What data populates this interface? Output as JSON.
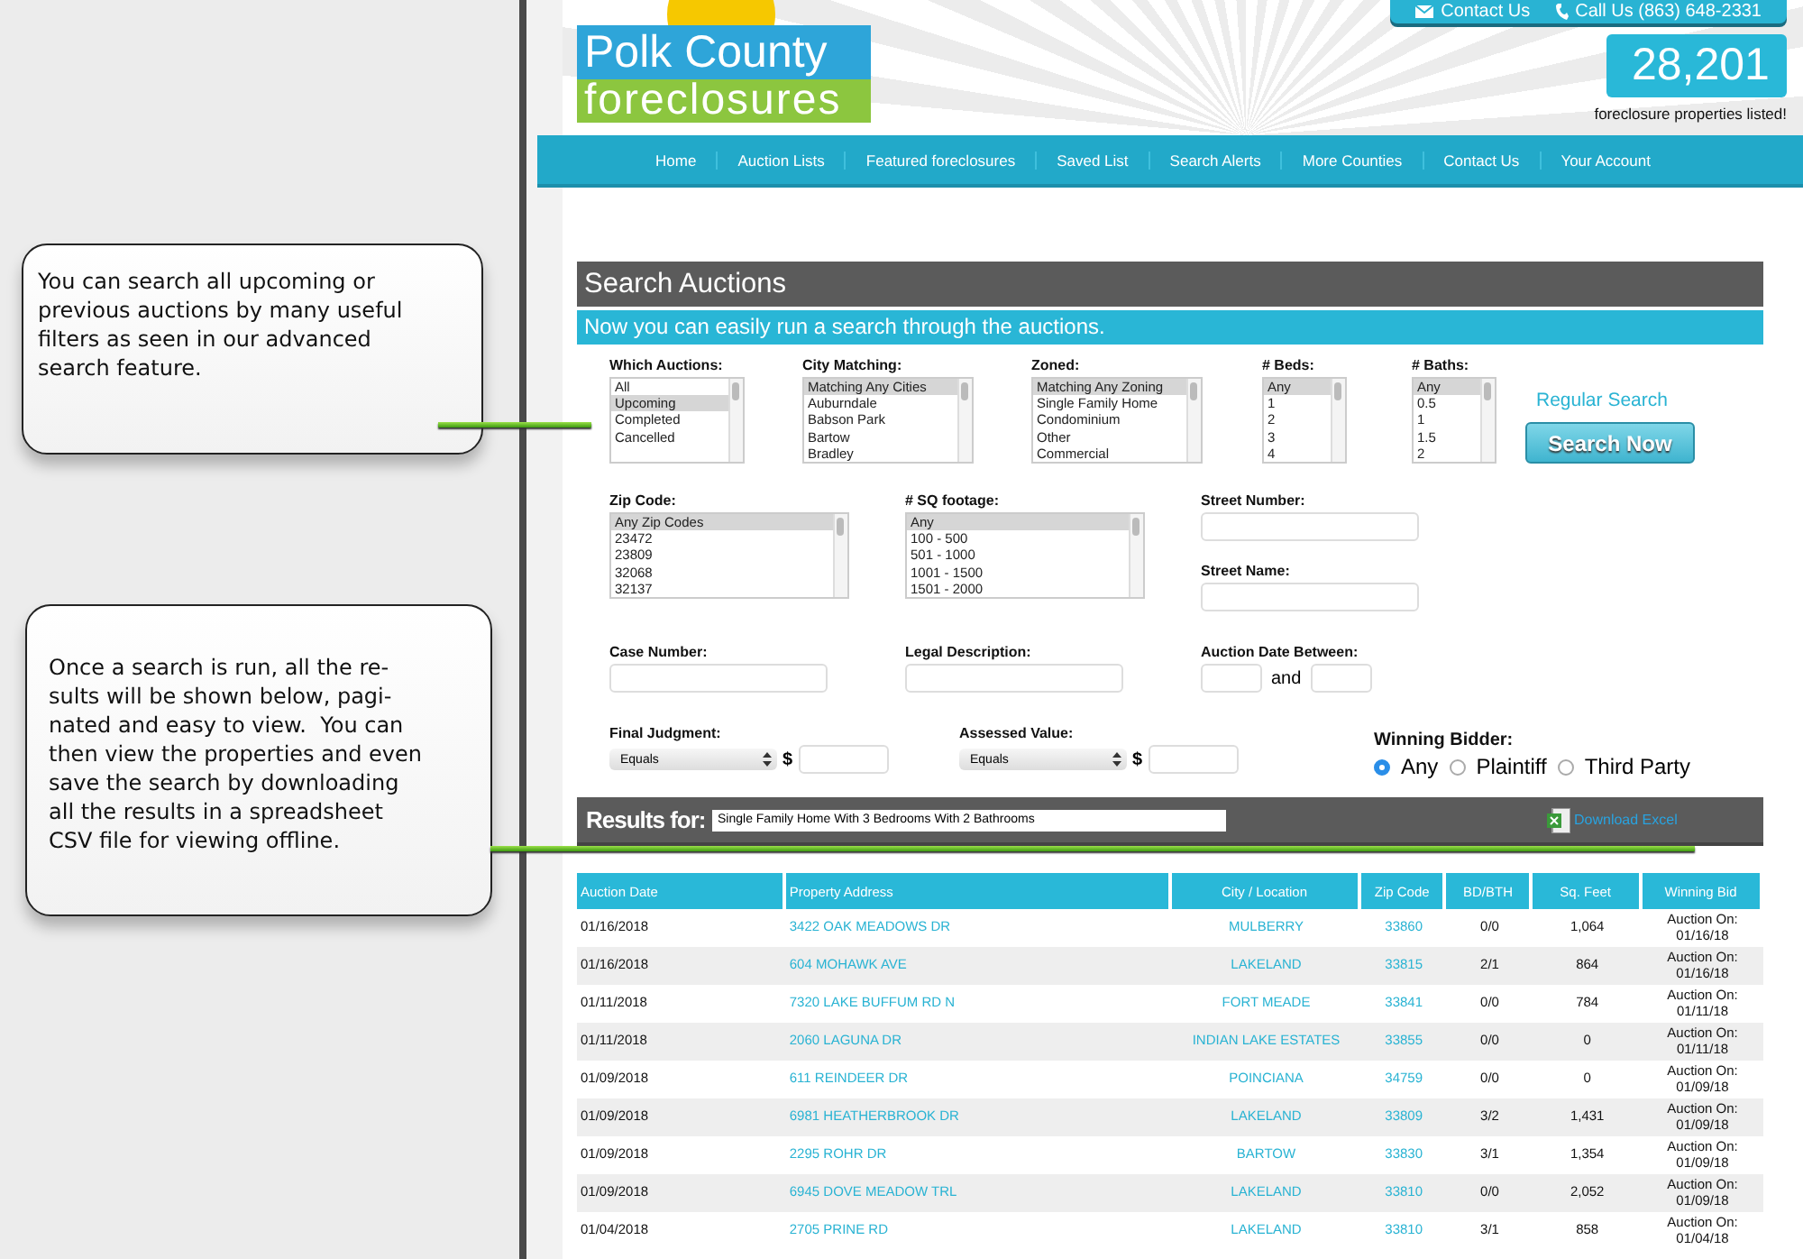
{
  "callouts": [
    {
      "text": "You can search all upcoming or\nprevious auctions by many useful\nfilters as seen in our advanced\nsearch feature."
    },
    {
      "text": "Once a search is run, all the re-\nsults will be shown below, pagi-\nnated and easy to view.  You can\nthen view the properties and even\nsave the search by downloading\nall the results in a spreadsheet\nCSV file for viewing offline."
    }
  ],
  "header": {
    "logo_top": "Polk County",
    "logo_bottom": "foreclosures",
    "contact_links": [
      "Contact Us",
      "Call Us (863) 648-2331"
    ],
    "count": "28,201",
    "count_caption": "foreclosure properties listed!"
  },
  "nav": [
    "Home",
    "Auction Lists",
    "Featured foreclosures",
    "Saved List",
    "Search Alerts",
    "More Counties",
    "Contact Us",
    "Your Account"
  ],
  "search": {
    "title": "Search Auctions",
    "subtitle": "Now you can easily run a search through the auctions.",
    "row_1": [
      {
        "label": "Which Auctions:",
        "options": [
          {
            "text": "All",
            "selected": false
          },
          {
            "text": "Upcoming",
            "selected": true
          },
          {
            "text": "Completed",
            "selected": false
          },
          {
            "text": "Cancelled",
            "selected": false
          }
        ]
      },
      {
        "label": "City Matching:",
        "options": [
          {
            "text": "Matching Any Cities",
            "selected": true
          },
          {
            "text": "Auburndale",
            "selected": false
          },
          {
            "text": "Babson Park",
            "selected": false
          },
          {
            "text": "Bartow",
            "selected": false
          },
          {
            "text": "Bradley",
            "selected": false
          }
        ]
      },
      {
        "label": "Zoned:",
        "options": [
          {
            "text": "Matching Any Zoning",
            "selected": true
          },
          {
            "text": "Single Family Home",
            "selected": false
          },
          {
            "text": "Condominium",
            "selected": false
          },
          {
            "text": "Other",
            "selected": false
          },
          {
            "text": "Commercial",
            "selected": false
          }
        ]
      },
      {
        "label": "# Beds:",
        "options": [
          {
            "text": "Any",
            "selected": true
          },
          {
            "text": "1",
            "selected": false
          },
          {
            "text": "2",
            "selected": false
          },
          {
            "text": "3",
            "selected": false
          },
          {
            "text": "4",
            "selected": false
          }
        ]
      },
      {
        "label": "# Baths:",
        "options": [
          {
            "text": "Any",
            "selected": true
          },
          {
            "text": "0.5",
            "selected": false
          },
          {
            "text": "1",
            "selected": false
          },
          {
            "text": "1.5",
            "selected": false
          },
          {
            "text": "2",
            "selected": false
          }
        ]
      }
    ],
    "regular_search": "Regular Search",
    "search_button": "Search Now",
    "row_2": [
      {
        "label": "Zip Code:",
        "options": [
          {
            "text": "Any Zip Codes",
            "selected": true
          },
          {
            "text": "23472",
            "selected": false
          },
          {
            "text": "23809",
            "selected": false
          },
          {
            "text": "32068",
            "selected": false
          },
          {
            "text": "32137",
            "selected": false
          }
        ]
      },
      {
        "label": "# SQ footage:",
        "options": [
          {
            "text": "Any",
            "selected": true
          },
          {
            "text": "100 - 500",
            "selected": false
          },
          {
            "text": "501 - 1000",
            "selected": false
          },
          {
            "text": "1001 - 1500",
            "selected": false
          },
          {
            "text": "1501 - 2000",
            "selected": false
          }
        ]
      }
    ],
    "street_number_label": "Street Number:",
    "street_name_label": "Street Name:",
    "case_number_label": "Case Number:",
    "legal_description_label": "Legal Description:",
    "date_between_label": "Auction Date Between:",
    "date_and": "and",
    "amounts": [
      {
        "label": "Final Judgment:",
        "operator": "Equals",
        "currency": "$"
      },
      {
        "label": "Assessed Value:",
        "operator": "Equals",
        "currency": "$"
      }
    ],
    "winning_bidder": {
      "label": "Winning Bidder:",
      "options": [
        {
          "text": "Any",
          "selected": true
        },
        {
          "text": "Plaintiff",
          "selected": false
        },
        {
          "text": "Third Party",
          "selected": false
        }
      ]
    }
  },
  "results": {
    "label": "Results for:",
    "query": "Single Family Home With 3 Bedrooms With 2 Bathrooms",
    "download": "Download Excel",
    "columns": [
      "Auction Date",
      "Property Address",
      "City / Location",
      "Zip Code",
      "BD/BTH",
      "Sq. Feet",
      "Winning Bid"
    ],
    "rows": [
      [
        "01/16/2018",
        "3422 OAK MEADOWS DR",
        "MULBERRY",
        "33860",
        "0/0",
        "1,064",
        "Auction On:\n01/16/18"
      ],
      [
        "01/16/2018",
        "604 MOHAWK AVE",
        "LAKELAND",
        "33815",
        "2/1",
        "864",
        "Auction On:\n01/16/18"
      ],
      [
        "01/11/2018",
        "7320 LAKE BUFFUM RD N",
        "FORT MEADE",
        "33841",
        "0/0",
        "784",
        "Auction On:\n01/11/18"
      ],
      [
        "01/11/2018",
        "2060 LAGUNA DR",
        "INDIAN LAKE ESTATES",
        "33855",
        "0/0",
        "0",
        "Auction On:\n01/11/18"
      ],
      [
        "01/09/2018",
        "611 REINDEER DR",
        "POINCIANA",
        "34759",
        "0/0",
        "0",
        "Auction On:\n01/09/18"
      ],
      [
        "01/09/2018",
        "6981 HEATHERBROOK DR",
        "LAKELAND",
        "33809",
        "3/2",
        "1,431",
        "Auction On:\n01/09/18"
      ],
      [
        "01/09/2018",
        "2295 ROHR DR",
        "BARTOW",
        "33830",
        "3/1",
        "1,354",
        "Auction On:\n01/09/18"
      ],
      [
        "01/09/2018",
        "6945 DOVE MEADOW TRL",
        "LAKELAND",
        "33810",
        "0/0",
        "2,052",
        "Auction On:\n01/09/18"
      ],
      [
        "01/04/2018",
        "2705 PRINE RD",
        "LAKELAND",
        "33810",
        "3/1",
        "858",
        "Auction On:\n01/04/18"
      ]
    ]
  }
}
